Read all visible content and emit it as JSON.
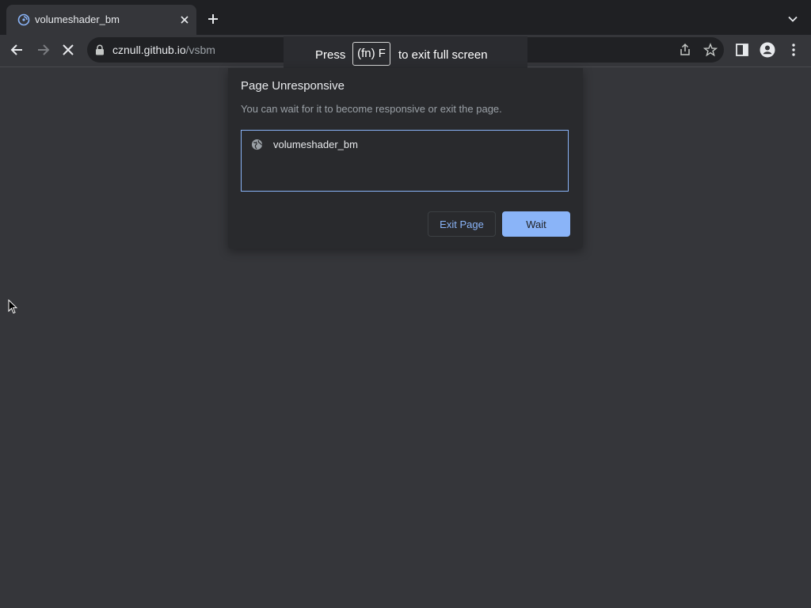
{
  "browser": {
    "tab": {
      "title": "volumeshader_bm"
    },
    "omnibox": {
      "host": "cznull.github.io",
      "path": "/vsbm"
    },
    "icons": {
      "favicon": "site-favicon-icon",
      "close": "close-icon",
      "new_tab": "plus-icon",
      "tab_search": "chevron-down-icon",
      "back": "arrow-left-icon",
      "forward": "arrow-right-icon",
      "stop": "close-icon",
      "lock": "lock-icon",
      "share": "share-icon",
      "bookmark": "star-icon",
      "side_panel": "side-panel-icon",
      "profile": "profile-icon",
      "menu": "kebab-menu-icon"
    }
  },
  "fullscreen_banner": {
    "prefix": "Press",
    "key": "(fn) F",
    "suffix": "to exit full screen"
  },
  "dialog": {
    "title": "Page Unresponsive",
    "message": "You can wait for it to become responsive or exit the page.",
    "pages": [
      {
        "label": "volumeshader_bm",
        "icon": "globe-icon"
      }
    ],
    "buttons": {
      "exit": "Exit Page",
      "wait": "Wait"
    }
  },
  "colors": {
    "accent": "#8ab4f8",
    "page_background": "#35363a",
    "dialog_background": "#292a2d"
  }
}
